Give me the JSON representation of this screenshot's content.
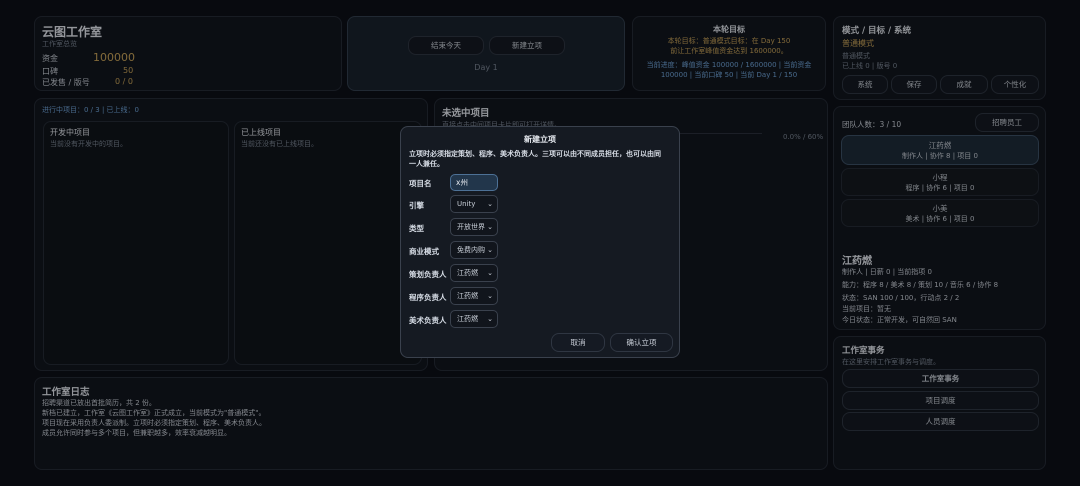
{
  "studio": {
    "title": "云图工作室",
    "subtitle": "工作室总览",
    "rows": [
      {
        "label": "资金",
        "value": "100000"
      },
      {
        "label": "口碑",
        "value": "50"
      },
      {
        "label": "已发售 / 版号",
        "value": "0 / 0"
      }
    ]
  },
  "controls": {
    "end_day": "结束今天",
    "new_project": "新建立项",
    "day": "Day 1"
  },
  "goal": {
    "title": "本轮目标",
    "line1": "本轮目标：普通模式目标：在 Day 150",
    "line2": "前让工作室峰值资金达到 1600000。",
    "line3": "当前进度：峰值资金 100000 / 1600000 | 当前资金",
    "line4": "100000 | 当前口碑 50 | 当前 Day 1 / 150"
  },
  "mode": {
    "title": "模式 / 目标 / 系统",
    "mode_name": "普通模式",
    "line1": "普通模式",
    "line2": "已上线 0 | 版号 0",
    "buttons": [
      "系统",
      "保存",
      "成就",
      "个性化"
    ]
  },
  "projects": {
    "header": "进行中项目：0 / 3 | 已上线：0",
    "dev_title": "开发中项目",
    "dev_empty": "当前没有开发中的项目。",
    "live_title": "已上线项目",
    "live_empty": "当前还没有已上线项目。"
  },
  "unselected": {
    "title": "未选中项目",
    "hint": "直接点击中间项目卡片即可打开详情。",
    "progress": "0.0% / 60%"
  },
  "team": {
    "count": "团队人数：3 / 10",
    "recruit": "招聘员工",
    "members": [
      {
        "name": "江药燃",
        "detail": "制作人 | 协作 8 | 项目 0"
      },
      {
        "name": "小程",
        "detail": "程序 | 协作 6 | 项目 0"
      },
      {
        "name": "小美",
        "detail": "美术 | 协作 6 | 项目 0"
      }
    ],
    "selected": {
      "name": "江药燃",
      "line1": "制作人 | 日薪 0 | 当前指项 0",
      "line2": "能力：程序 8 / 美术 8 / 策划 10 / 音乐 6 / 协作 8",
      "line3": "状态：SAN 100 / 100，行动点 2 / 2",
      "line4": "当前项目：暂无",
      "line5": "今日状态：正常开发，可自然回 SAN"
    }
  },
  "affairs": {
    "title": "工作室事务",
    "subtitle": "在这里安排工作室事务与调度。",
    "buttons": [
      "工作室事务",
      "项目调度",
      "人员调度"
    ]
  },
  "log": {
    "title": "工作室日志",
    "lines": [
      "招聘渠道已放出首批简历，共 2 份。",
      "新档已建立，工作室《云图工作室》正式成立，当前模式为\"普通模式\"。",
      "项目现在采用负责人委派制。立项时必须指定策划、程序、美术负责人。",
      "成员允许同时参与多个项目，但兼职越多，效率衰减越明显。"
    ]
  },
  "modal": {
    "title": "新建立项",
    "desc1": "立项时必须指定策划、程序、美术负责人。三项可以由不同成员担任，也可以由同",
    "desc2": "一人兼任。",
    "name_label": "项目名",
    "name_value": "x州",
    "fields": [
      {
        "label": "引擎",
        "value": "Unity"
      },
      {
        "label": "类型",
        "value": "开放世界"
      },
      {
        "label": "商业模式",
        "value": "免费内购"
      },
      {
        "label": "策划负责人",
        "value": "江药燃"
      },
      {
        "label": "程序负责人",
        "value": "江药燃"
      },
      {
        "label": "美术负责人",
        "value": "江药燃"
      }
    ],
    "cancel": "取消",
    "confirm": "确认立项"
  }
}
